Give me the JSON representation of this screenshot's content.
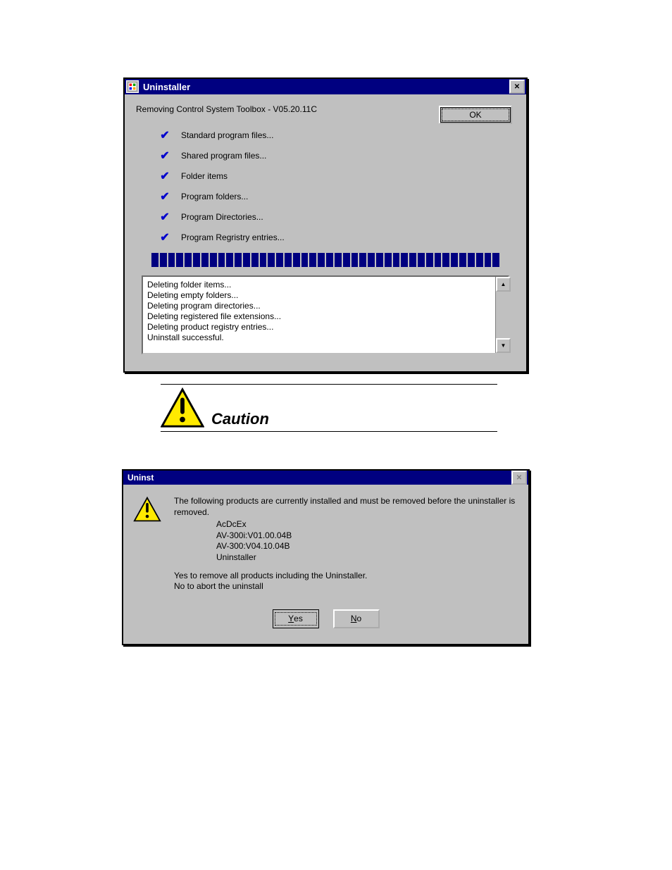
{
  "win1": {
    "title": "Uninstaller",
    "headline": "Removing Control System Toolbox - V05.20.11C",
    "ok": "OK",
    "items": [
      "Standard program files...",
      "Shared program files...",
      "Folder items",
      "Program folders...",
      "Program Directories...",
      "Program Regristry entries..."
    ],
    "log": "Deleting folder items...\nDeleting empty folders...\nDeleting program directories...\nDeleting registered file extensions...\nDeleting product registry entries...\nUninstall successful."
  },
  "caution": {
    "label": "Caution"
  },
  "win2": {
    "title": "Uninst",
    "msg_top": "The following products are currently installed and must be removed before the uninstaller is removed.",
    "products": [
      "AcDcEx",
      "AV-300i:V01.00.04B",
      "AV-300:V04.10.04B",
      "Uninstaller"
    ],
    "msg_bottom1": "Yes to remove all products including the Uninstaller.",
    "msg_bottom2": "No  to abort the uninstall",
    "yes": "Yes",
    "no": "No"
  },
  "icons": {
    "check": "✔",
    "close": "✕",
    "up": "▲",
    "down": "▼"
  }
}
